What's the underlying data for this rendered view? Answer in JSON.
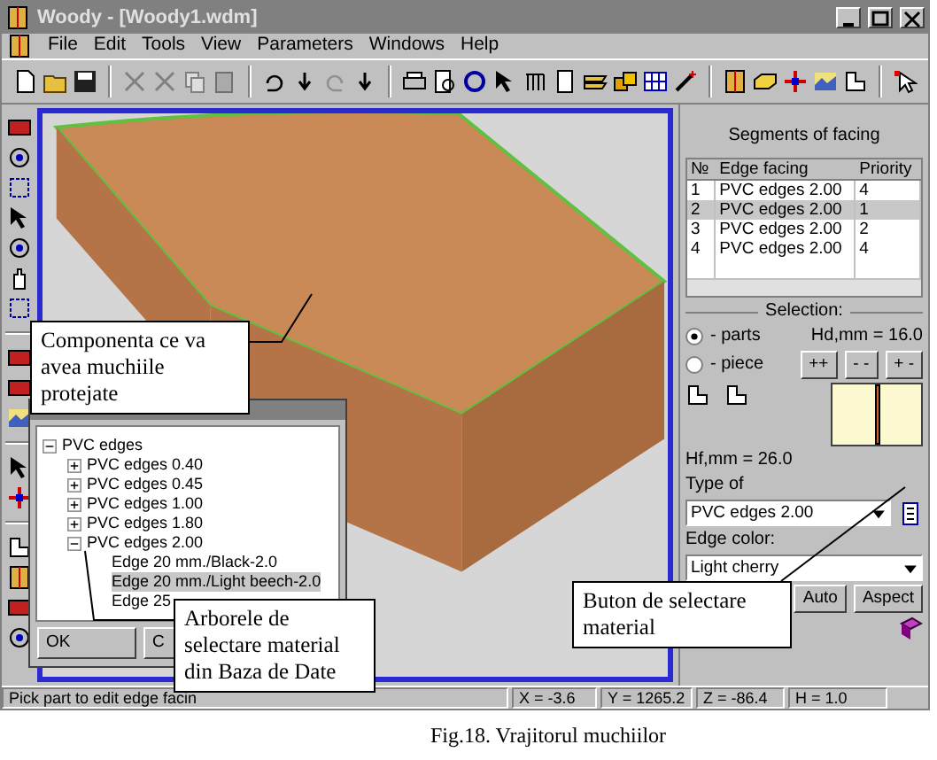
{
  "window": {
    "title": "Woody - [Woody1.wdm]"
  },
  "menu": [
    "File",
    "Edit",
    "Tools",
    "View",
    "Parameters",
    "Windows",
    "Help"
  ],
  "right_panel": {
    "title": "Segments of facing",
    "table": {
      "columns": [
        "№",
        "Edge facing",
        "Priority"
      ],
      "rows": [
        {
          "cells": [
            "1",
            "PVC edges 2.00",
            "4"
          ],
          "selected": false
        },
        {
          "cells": [
            "2",
            "PVC edges 2.00",
            "1"
          ],
          "selected": true
        },
        {
          "cells": [
            "3",
            "PVC edges 2.00",
            "2"
          ],
          "selected": false
        },
        {
          "cells": [
            "4",
            "PVC edges 2.00",
            "4"
          ],
          "selected": false
        }
      ]
    },
    "selection": {
      "title": "Selection:",
      "options": [
        {
          "label": "- parts",
          "selected": true
        },
        {
          "label": "- piece",
          "selected": false
        }
      ],
      "hd": "Hd,mm = 16.0",
      "buttons": [
        "++",
        "- -",
        "+ -"
      ]
    },
    "hf": "Hf,mm =  26.0",
    "type_label": "Type of",
    "type_value": "PVC edges 2.00",
    "color_label": "Edge color:",
    "color_value": "Light cherry",
    "buttons": [
      "Auto",
      "Aspect"
    ]
  },
  "dialog": {
    "tree": [
      {
        "label": "PVC edges",
        "expanded": true,
        "children": [
          {
            "label": "PVC edges 0.40",
            "expanded": false
          },
          {
            "label": "PVC edges 0.45",
            "expanded": false
          },
          {
            "label": "PVC edges 1.00",
            "expanded": false
          },
          {
            "label": "PVC edges 1.80",
            "expanded": false
          },
          {
            "label": "PVC edges 2.00",
            "expanded": true,
            "children": [
              {
                "label": "Edge 20 mm./Black-2.0",
                "selected": false
              },
              {
                "label": "Edge 20 mm./Light beech-2.0",
                "selected": true
              },
              {
                "label": "Edge 25",
                "selected": false
              }
            ]
          }
        ]
      }
    ],
    "buttons": [
      "OK",
      "C"
    ]
  },
  "callouts": [
    "Componenta ce va avea muchiile protejate",
    "Arborele de selectare material din Baza de Date",
    "Buton de selectare material"
  ],
  "status_bar": {
    "message": "Pick part to edit edge facin",
    "x": "X = -3.6",
    "y": "Y = 1265.2",
    "z": "Z = -86.4",
    "h": "H = 1.0"
  },
  "caption": "Fig.18. Vrajitorul muchiilor"
}
